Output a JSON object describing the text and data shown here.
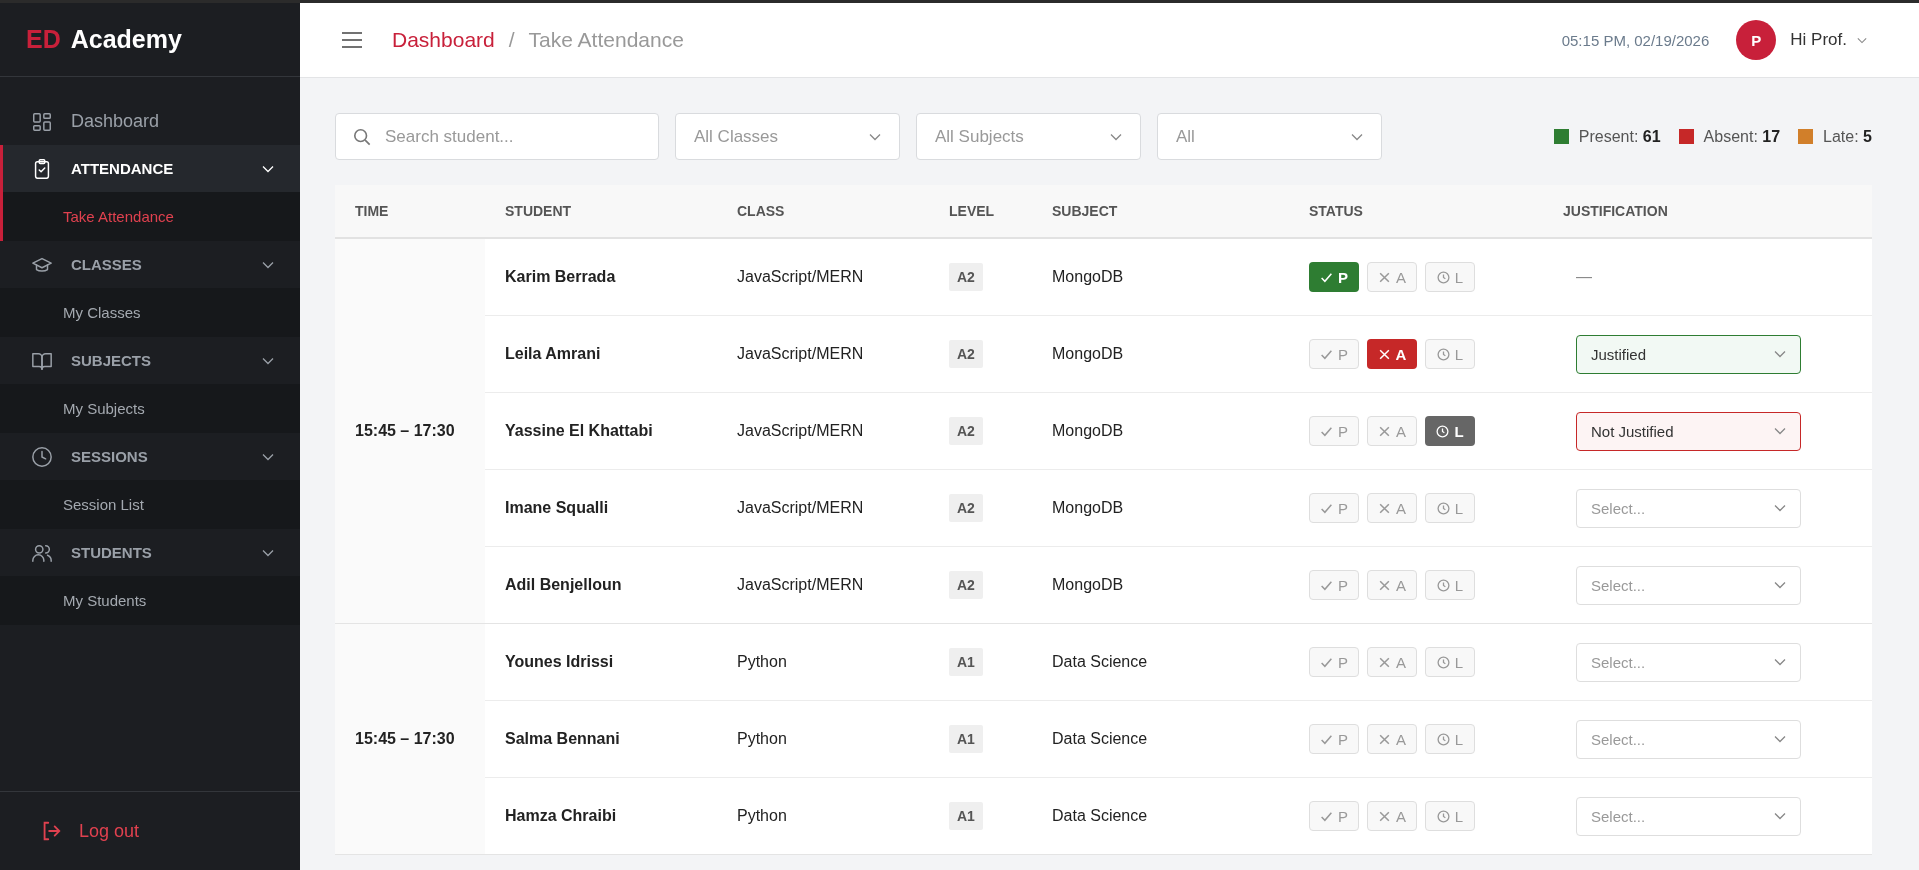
{
  "brand": {
    "mark": "ED",
    "name": "Academy"
  },
  "sidebar": {
    "items": [
      {
        "kind": "link",
        "label": "Dashboard",
        "selected": false
      },
      {
        "kind": "group",
        "label": "ATTENDANCE",
        "selected": true,
        "children": [
          {
            "label": "Take Attendance",
            "selected": true
          }
        ]
      },
      {
        "kind": "group",
        "label": "CLASSES",
        "selected": false,
        "children": [
          {
            "label": "My Classes",
            "selected": false
          }
        ]
      },
      {
        "kind": "group",
        "label": "SUBJECTS",
        "selected": false,
        "children": [
          {
            "label": "My Subjects",
            "selected": false
          }
        ]
      },
      {
        "kind": "group",
        "label": "SESSIONS",
        "selected": false,
        "children": [
          {
            "label": "Session List",
            "selected": false
          }
        ]
      },
      {
        "kind": "group",
        "label": "STUDENTS",
        "selected": false,
        "children": [
          {
            "label": "My Students",
            "selected": false
          }
        ]
      }
    ],
    "logout": "Log out"
  },
  "header": {
    "breadcrumb": [
      {
        "label": "Dashboard"
      },
      {
        "label": "Take Attendance"
      }
    ],
    "separator": "/",
    "datetime": "05:15 PM, 02/19/2026",
    "avatar": "P",
    "greeting": "Hi Prof."
  },
  "filters": {
    "search": {
      "placeholder": "Search student..."
    },
    "dropdowns": [
      {
        "value": "All Classes"
      },
      {
        "value": "All Subjects"
      },
      {
        "value": "All"
      }
    ]
  },
  "stats": [
    {
      "label": "Present:",
      "count": "61",
      "color": "#2e7d32"
    },
    {
      "label": "Absent:",
      "count": "17",
      "color": "#c62828"
    },
    {
      "label": "Late:",
      "count": "5",
      "color": "#d17f2a"
    }
  ],
  "table": {
    "columns": [
      "TIME",
      "STUDENT",
      "CLASS",
      "LEVEL",
      "SUBJECT",
      "STATUS",
      "JUSTIFICATION"
    ],
    "sessions": [
      {
        "time": "15:45 – 17:30",
        "rows": [
          {
            "student": "Karim Berrada",
            "class": "JavaScript/MERN",
            "level": "A2",
            "subject": "MongoDB",
            "status": [
              {
                "kind": "present",
                "label": "P",
                "selected": true
              },
              {
                "kind": "absent",
                "label": "A",
                "selected": false
              },
              {
                "kind": "late",
                "label": "L",
                "selected": false
              }
            ],
            "justification": {
              "kind": "dash",
              "text": "—"
            }
          },
          {
            "student": "Leila Amrani",
            "class": "JavaScript/MERN",
            "level": "A2",
            "subject": "MongoDB",
            "status": [
              {
                "kind": "present",
                "label": "P",
                "selected": false
              },
              {
                "kind": "absent",
                "label": "A",
                "selected": true
              },
              {
                "kind": "late",
                "label": "L",
                "selected": false
              }
            ],
            "justification": {
              "kind": "select",
              "value": "Justified",
              "justified": true
            }
          },
          {
            "student": "Yassine El Khattabi",
            "class": "JavaScript/MERN",
            "level": "A2",
            "subject": "MongoDB",
            "status": [
              {
                "kind": "present",
                "label": "P",
                "selected": false
              },
              {
                "kind": "absent",
                "label": "A",
                "selected": false
              },
              {
                "kind": "late",
                "label": "L",
                "selected": true
              }
            ],
            "justification": {
              "kind": "select",
              "value": "Not Justified",
              "justified": false
            }
          },
          {
            "student": "Imane Squalli",
            "class": "JavaScript/MERN",
            "level": "A2",
            "subject": "MongoDB",
            "status": [
              {
                "kind": "present",
                "label": "P",
                "selected": false
              },
              {
                "kind": "absent",
                "label": "A",
                "selected": false
              },
              {
                "kind": "late",
                "label": "L",
                "selected": false
              }
            ],
            "justification": {
              "kind": "select",
              "placeholder": "Select..."
            }
          },
          {
            "student": "Adil Benjelloun",
            "class": "JavaScript/MERN",
            "level": "A2",
            "subject": "MongoDB",
            "status": [
              {
                "kind": "present",
                "label": "P",
                "selected": false
              },
              {
                "kind": "absent",
                "label": "A",
                "selected": false
              },
              {
                "kind": "late",
                "label": "L",
                "selected": false
              }
            ],
            "justification": {
              "kind": "select",
              "placeholder": "Select..."
            }
          }
        ]
      },
      {
        "time": "15:45 – 17:30",
        "rows": [
          {
            "student": "Younes Idrissi",
            "class": "Python",
            "level": "A1",
            "subject": "Data Science",
            "status": [
              {
                "kind": "present",
                "label": "P",
                "selected": false
              },
              {
                "kind": "absent",
                "label": "A",
                "selected": false
              },
              {
                "kind": "late",
                "label": "L",
                "selected": false
              }
            ],
            "justification": {
              "kind": "select",
              "placeholder": "Select..."
            }
          },
          {
            "student": "Salma Bennani",
            "class": "Python",
            "level": "A1",
            "subject": "Data Science",
            "status": [
              {
                "kind": "present",
                "label": "P",
                "selected": false
              },
              {
                "kind": "absent",
                "label": "A",
                "selected": false
              },
              {
                "kind": "late",
                "label": "L",
                "selected": false
              }
            ],
            "justification": {
              "kind": "select",
              "placeholder": "Select..."
            }
          },
          {
            "student": "Hamza Chraibi",
            "class": "Python",
            "level": "A1",
            "subject": "Data Science",
            "status": [
              {
                "kind": "present",
                "label": "P",
                "selected": false
              },
              {
                "kind": "absent",
                "label": "A",
                "selected": false
              },
              {
                "kind": "late",
                "label": "L",
                "selected": false
              }
            ],
            "justification": {
              "kind": "select",
              "placeholder": "Select..."
            }
          }
        ]
      }
    ]
  }
}
